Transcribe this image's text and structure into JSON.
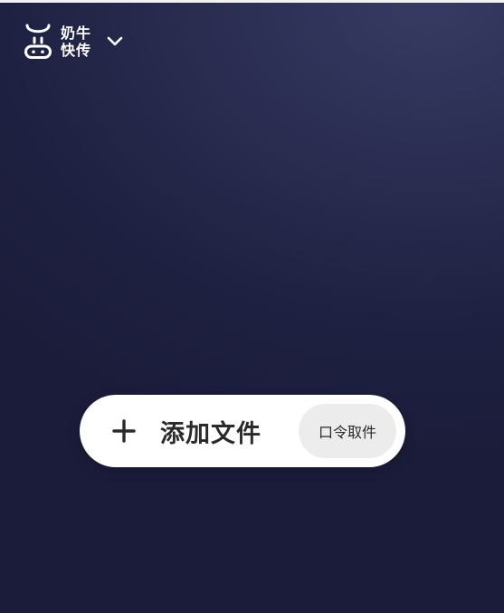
{
  "brand": {
    "logo_icon": "cow-face-icon",
    "name_line1": "奶牛",
    "name_line2": "快传",
    "menu_icon": "chevron-down-icon"
  },
  "actions": {
    "add_icon": "plus-icon",
    "add_file_label": "添加文件",
    "pickup_code_label": "口令取件"
  },
  "colors": {
    "background_top": "#373b63",
    "background_bottom": "#1b1c3a",
    "pill_background": "#ffffff",
    "secondary_button": "#ececec",
    "text_dark": "#2a2a2a"
  }
}
